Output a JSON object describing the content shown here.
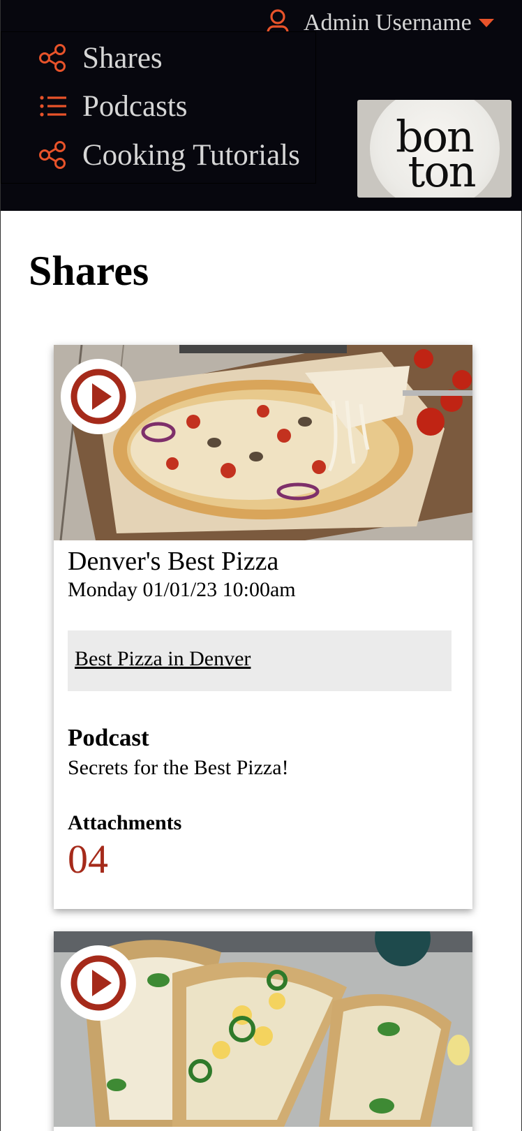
{
  "header": {
    "user_name": "Admin Username",
    "accent_color": "#e8532a",
    "nav": [
      {
        "label": "Shares",
        "icon": "share-icon"
      },
      {
        "label": "Podcasts",
        "icon": "list-icon"
      },
      {
        "label": "Cooking Tutorials",
        "icon": "share-icon"
      }
    ],
    "logo": {
      "line1": "bon",
      "line2": "ton"
    }
  },
  "main": {
    "title": "Shares",
    "cards": [
      {
        "image": "pizza-photo",
        "title": "Denver's Best Pizza",
        "date": "Monday 01/01/23 10:00am",
        "link": "Best Pizza in Denver",
        "podcast_heading": "Podcast",
        "podcast_title": "Secrets for the Best Pizza!",
        "attachments_heading": "Attachments",
        "attachments_count": "04"
      },
      {
        "image": "tacos-photo"
      }
    ]
  }
}
